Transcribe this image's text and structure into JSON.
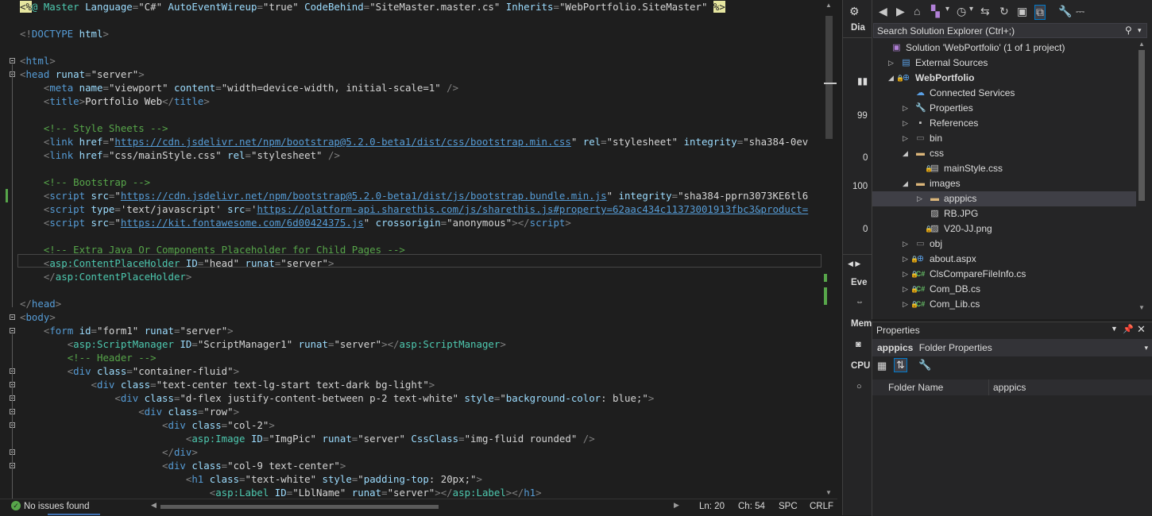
{
  "editor": {
    "lines": [
      [
        {
          "c": "dir",
          "t": "<%"
        },
        {
          "c": "asp",
          "t": "@ Master "
        },
        {
          "c": "attr",
          "t": "Language"
        },
        {
          "c": "pun",
          "t": "="
        },
        {
          "c": "val",
          "t": "\"C#\" "
        },
        {
          "c": "attr",
          "t": "AutoEventWireup"
        },
        {
          "c": "pun",
          "t": "="
        },
        {
          "c": "val",
          "t": "\"true\" "
        },
        {
          "c": "attr",
          "t": "CodeBehind"
        },
        {
          "c": "pun",
          "t": "="
        },
        {
          "c": "val",
          "t": "\"SiteMaster.master.cs\" "
        },
        {
          "c": "attr",
          "t": "Inherits"
        },
        {
          "c": "pun",
          "t": "="
        },
        {
          "c": "val",
          "t": "\"WebPortfolio.SiteMaster\" "
        },
        {
          "c": "dir",
          "t": "%>"
        }
      ],
      [],
      [
        {
          "c": "pun",
          "t": "<!"
        },
        {
          "c": "tag",
          "t": "DOCTYPE "
        },
        {
          "c": "attr",
          "t": "html"
        },
        {
          "c": "pun",
          "t": ">"
        }
      ],
      [],
      [
        {
          "c": "pun",
          "t": "<"
        },
        {
          "c": "tag",
          "t": "html"
        },
        {
          "c": "pun",
          "t": ">"
        }
      ],
      [
        {
          "c": "pun",
          "t": "<"
        },
        {
          "c": "tag",
          "t": "head "
        },
        {
          "c": "attr",
          "t": "runat"
        },
        {
          "c": "pun",
          "t": "="
        },
        {
          "c": "val",
          "t": "\"server\""
        },
        {
          "c": "pun",
          "t": ">"
        }
      ],
      [
        {
          "c": "txt",
          "t": "    "
        },
        {
          "c": "pun",
          "t": "<"
        },
        {
          "c": "tag",
          "t": "meta "
        },
        {
          "c": "attr",
          "t": "name"
        },
        {
          "c": "pun",
          "t": "="
        },
        {
          "c": "val",
          "t": "\"viewport\" "
        },
        {
          "c": "attr",
          "t": "content"
        },
        {
          "c": "pun",
          "t": "="
        },
        {
          "c": "val",
          "t": "\"width=device-width, initial-scale=1\" "
        },
        {
          "c": "pun",
          "t": "/>"
        }
      ],
      [
        {
          "c": "txt",
          "t": "    "
        },
        {
          "c": "pun",
          "t": "<"
        },
        {
          "c": "tag",
          "t": "title"
        },
        {
          "c": "pun",
          "t": ">"
        },
        {
          "c": "txt",
          "t": "Portfolio Web"
        },
        {
          "c": "pun",
          "t": "</"
        },
        {
          "c": "tag",
          "t": "title"
        },
        {
          "c": "pun",
          "t": ">"
        }
      ],
      [],
      [
        {
          "c": "txt",
          "t": "    "
        },
        {
          "c": "cmt",
          "t": "<!-- Style Sheets -->"
        }
      ],
      [
        {
          "c": "txt",
          "t": "    "
        },
        {
          "c": "pun",
          "t": "<"
        },
        {
          "c": "tag",
          "t": "link "
        },
        {
          "c": "attr",
          "t": "href"
        },
        {
          "c": "pun",
          "t": "="
        },
        {
          "c": "val",
          "t": "\""
        },
        {
          "c": "url",
          "t": "https://cdn.jsdelivr.net/npm/bootstrap@5.2.0-beta1/dist/css/bootstrap.min.css"
        },
        {
          "c": "val",
          "t": "\" "
        },
        {
          "c": "attr",
          "t": "rel"
        },
        {
          "c": "pun",
          "t": "="
        },
        {
          "c": "val",
          "t": "\"stylesheet\" "
        },
        {
          "c": "attr",
          "t": "integrity"
        },
        {
          "c": "pun",
          "t": "="
        },
        {
          "c": "val",
          "t": "\"sha384-0ev"
        }
      ],
      [
        {
          "c": "txt",
          "t": "    "
        },
        {
          "c": "pun",
          "t": "<"
        },
        {
          "c": "tag",
          "t": "link "
        },
        {
          "c": "attr",
          "t": "href"
        },
        {
          "c": "pun",
          "t": "="
        },
        {
          "c": "val",
          "t": "\"css/mainStyle.css\" "
        },
        {
          "c": "attr",
          "t": "rel"
        },
        {
          "c": "pun",
          "t": "="
        },
        {
          "c": "val",
          "t": "\"stylesheet\" "
        },
        {
          "c": "pun",
          "t": "/>"
        }
      ],
      [],
      [
        {
          "c": "txt",
          "t": "    "
        },
        {
          "c": "cmt",
          "t": "<!-- Bootstrap -->"
        }
      ],
      [
        {
          "c": "txt",
          "t": "    "
        },
        {
          "c": "pun",
          "t": "<"
        },
        {
          "c": "tag",
          "t": "script "
        },
        {
          "c": "attr",
          "t": "src"
        },
        {
          "c": "pun",
          "t": "="
        },
        {
          "c": "val",
          "t": "\""
        },
        {
          "c": "url",
          "t": "https://cdn.jsdelivr.net/npm/bootstrap@5.2.0-beta1/dist/js/bootstrap.bundle.min.js"
        },
        {
          "c": "val",
          "t": "\" "
        },
        {
          "c": "attr",
          "t": "integrity"
        },
        {
          "c": "pun",
          "t": "="
        },
        {
          "c": "val",
          "t": "\"sha384-pprn3073KE6tl6"
        }
      ],
      [
        {
          "c": "txt",
          "t": "    "
        },
        {
          "c": "pun",
          "t": "<"
        },
        {
          "c": "tag",
          "t": "script "
        },
        {
          "c": "attr",
          "t": "type"
        },
        {
          "c": "pun",
          "t": "="
        },
        {
          "c": "val",
          "t": "'text/javascript' "
        },
        {
          "c": "attr",
          "t": "src"
        },
        {
          "c": "pun",
          "t": "="
        },
        {
          "c": "val",
          "t": "'"
        },
        {
          "c": "url",
          "t": "https://platform-api.sharethis.com/js/sharethis.js#property=62aac434c11373001913fbc3&product="
        }
      ],
      [
        {
          "c": "txt",
          "t": "    "
        },
        {
          "c": "pun",
          "t": "<"
        },
        {
          "c": "tag",
          "t": "script "
        },
        {
          "c": "attr",
          "t": "src"
        },
        {
          "c": "pun",
          "t": "="
        },
        {
          "c": "val",
          "t": "\""
        },
        {
          "c": "url",
          "t": "https://kit.fontawesome.com/6d00424375.js"
        },
        {
          "c": "val",
          "t": "\" "
        },
        {
          "c": "attr",
          "t": "crossorigin"
        },
        {
          "c": "pun",
          "t": "="
        },
        {
          "c": "val",
          "t": "\"anonymous\""
        },
        {
          "c": "pun",
          "t": "></"
        },
        {
          "c": "tag",
          "t": "script"
        },
        {
          "c": "pun",
          "t": ">"
        }
      ],
      [],
      [
        {
          "c": "txt",
          "t": "    "
        },
        {
          "c": "cmt",
          "t": "<!-- Extra Java Or Components Placeholder for Child Pages -->"
        }
      ],
      [
        {
          "c": "txt",
          "t": "    "
        },
        {
          "c": "pun",
          "t": "<"
        },
        {
          "c": "asp",
          "t": "asp:ContentPlaceHolder "
        },
        {
          "c": "attr",
          "t": "ID"
        },
        {
          "c": "pun",
          "t": "="
        },
        {
          "c": "val",
          "t": "\"head\" "
        },
        {
          "c": "attr",
          "t": "runat"
        },
        {
          "c": "pun",
          "t": "="
        },
        {
          "c": "val",
          "t": "\"server\""
        },
        {
          "c": "pun",
          "t": ">"
        }
      ],
      [
        {
          "c": "txt",
          "t": "    "
        },
        {
          "c": "pun",
          "t": "</"
        },
        {
          "c": "asp",
          "t": "asp:ContentPlaceHolder"
        },
        {
          "c": "pun",
          "t": ">"
        }
      ],
      [],
      [
        {
          "c": "pun",
          "t": "</"
        },
        {
          "c": "tag",
          "t": "head"
        },
        {
          "c": "pun",
          "t": ">"
        }
      ],
      [
        {
          "c": "pun",
          "t": "<"
        },
        {
          "c": "tag",
          "t": "body"
        },
        {
          "c": "pun",
          "t": ">"
        }
      ],
      [
        {
          "c": "txt",
          "t": "    "
        },
        {
          "c": "pun",
          "t": "<"
        },
        {
          "c": "tag",
          "t": "form "
        },
        {
          "c": "attr",
          "t": "id"
        },
        {
          "c": "pun",
          "t": "="
        },
        {
          "c": "val",
          "t": "\"form1\" "
        },
        {
          "c": "attr",
          "t": "runat"
        },
        {
          "c": "pun",
          "t": "="
        },
        {
          "c": "val",
          "t": "\"server\""
        },
        {
          "c": "pun",
          "t": ">"
        }
      ],
      [
        {
          "c": "txt",
          "t": "        "
        },
        {
          "c": "pun",
          "t": "<"
        },
        {
          "c": "asp",
          "t": "asp:ScriptManager "
        },
        {
          "c": "attr",
          "t": "ID"
        },
        {
          "c": "pun",
          "t": "="
        },
        {
          "c": "val",
          "t": "\"ScriptManager1\" "
        },
        {
          "c": "attr",
          "t": "runat"
        },
        {
          "c": "pun",
          "t": "="
        },
        {
          "c": "val",
          "t": "\"server\""
        },
        {
          "c": "pun",
          "t": "></"
        },
        {
          "c": "asp",
          "t": "asp:ScriptManager"
        },
        {
          "c": "pun",
          "t": ">"
        }
      ],
      [
        {
          "c": "txt",
          "t": "        "
        },
        {
          "c": "cmt",
          "t": "<!-- Header -->"
        }
      ],
      [
        {
          "c": "txt",
          "t": "        "
        },
        {
          "c": "pun",
          "t": "<"
        },
        {
          "c": "tag",
          "t": "div "
        },
        {
          "c": "attr",
          "t": "class"
        },
        {
          "c": "pun",
          "t": "="
        },
        {
          "c": "val",
          "t": "\"container-fluid\""
        },
        {
          "c": "pun",
          "t": ">"
        }
      ],
      [
        {
          "c": "txt",
          "t": "            "
        },
        {
          "c": "pun",
          "t": "<"
        },
        {
          "c": "tag",
          "t": "div "
        },
        {
          "c": "attr",
          "t": "class"
        },
        {
          "c": "pun",
          "t": "="
        },
        {
          "c": "val",
          "t": "\"text-center text-lg-start text-dark bg-light\""
        },
        {
          "c": "pun",
          "t": ">"
        }
      ],
      [
        {
          "c": "txt",
          "t": "                "
        },
        {
          "c": "pun",
          "t": "<"
        },
        {
          "c": "tag",
          "t": "div "
        },
        {
          "c": "attr",
          "t": "class"
        },
        {
          "c": "pun",
          "t": "="
        },
        {
          "c": "val",
          "t": "\"d-flex justify-content-between p-2 text-white\" "
        },
        {
          "c": "attr",
          "t": "style"
        },
        {
          "c": "pun",
          "t": "="
        },
        {
          "c": "val",
          "t": "\""
        },
        {
          "c": "attr",
          "t": "background-color"
        },
        {
          "c": "val",
          "t": ": blue;\""
        },
        {
          "c": "pun",
          "t": ">"
        }
      ],
      [
        {
          "c": "txt",
          "t": "                    "
        },
        {
          "c": "pun",
          "t": "<"
        },
        {
          "c": "tag",
          "t": "div "
        },
        {
          "c": "attr",
          "t": "class"
        },
        {
          "c": "pun",
          "t": "="
        },
        {
          "c": "val",
          "t": "\"row\""
        },
        {
          "c": "pun",
          "t": ">"
        }
      ],
      [
        {
          "c": "txt",
          "t": "                        "
        },
        {
          "c": "pun",
          "t": "<"
        },
        {
          "c": "tag",
          "t": "div "
        },
        {
          "c": "attr",
          "t": "class"
        },
        {
          "c": "pun",
          "t": "="
        },
        {
          "c": "val",
          "t": "\"col-2\""
        },
        {
          "c": "pun",
          "t": ">"
        }
      ],
      [
        {
          "c": "txt",
          "t": "                            "
        },
        {
          "c": "pun",
          "t": "<"
        },
        {
          "c": "asp",
          "t": "asp:Image "
        },
        {
          "c": "attr",
          "t": "ID"
        },
        {
          "c": "pun",
          "t": "="
        },
        {
          "c": "val",
          "t": "\"ImgPic\" "
        },
        {
          "c": "attr",
          "t": "runat"
        },
        {
          "c": "pun",
          "t": "="
        },
        {
          "c": "val",
          "t": "\"server\" "
        },
        {
          "c": "attr",
          "t": "CssClass"
        },
        {
          "c": "pun",
          "t": "="
        },
        {
          "c": "val",
          "t": "\"img-fluid rounded\" "
        },
        {
          "c": "pun",
          "t": "/>"
        }
      ],
      [
        {
          "c": "txt",
          "t": "                        "
        },
        {
          "c": "pun",
          "t": "</"
        },
        {
          "c": "tag",
          "t": "div"
        },
        {
          "c": "pun",
          "t": ">"
        }
      ],
      [
        {
          "c": "txt",
          "t": "                        "
        },
        {
          "c": "pun",
          "t": "<"
        },
        {
          "c": "tag",
          "t": "div "
        },
        {
          "c": "attr",
          "t": "class"
        },
        {
          "c": "pun",
          "t": "="
        },
        {
          "c": "val",
          "t": "\"col-9 text-center\""
        },
        {
          "c": "pun",
          "t": ">"
        }
      ],
      [
        {
          "c": "txt",
          "t": "                            "
        },
        {
          "c": "pun",
          "t": "<"
        },
        {
          "c": "tag",
          "t": "h1 "
        },
        {
          "c": "attr",
          "t": "class"
        },
        {
          "c": "pun",
          "t": "="
        },
        {
          "c": "val",
          "t": "\"text-white\" "
        },
        {
          "c": "attr",
          "t": "style"
        },
        {
          "c": "pun",
          "t": "="
        },
        {
          "c": "val",
          "t": "\""
        },
        {
          "c": "attr",
          "t": "padding-top"
        },
        {
          "c": "val",
          "t": ": 20px;\""
        },
        {
          "c": "pun",
          "t": ">"
        }
      ],
      [
        {
          "c": "txt",
          "t": "                                "
        },
        {
          "c": "pun",
          "t": "<"
        },
        {
          "c": "asp",
          "t": "asp:Label "
        },
        {
          "c": "attr",
          "t": "ID"
        },
        {
          "c": "pun",
          "t": "="
        },
        {
          "c": "val",
          "t": "\"LblName\" "
        },
        {
          "c": "attr",
          "t": "runat"
        },
        {
          "c": "pun",
          "t": "="
        },
        {
          "c": "val",
          "t": "\"server\""
        },
        {
          "c": "pun",
          "t": "></"
        },
        {
          "c": "asp",
          "t": "asp:Label"
        },
        {
          "c": "pun",
          "t": "></"
        },
        {
          "c": "tag",
          "t": "h1"
        },
        {
          "c": "pun",
          "t": ">"
        }
      ]
    ]
  },
  "status": {
    "issues": "No issues found",
    "line": "Ln: 20",
    "col": "Ch: 54",
    "spacing": "SPC",
    "eol": "CRLF"
  },
  "middle_panel": {
    "diagnostics_label": "Dia",
    "values": [
      "99",
      "0",
      "100",
      "0"
    ],
    "events_label": "Eve",
    "memory_label": "Mem",
    "cpu_label": "CPU"
  },
  "solution_explorer": {
    "search_placeholder": "Search Solution Explorer (Ctrl+;)",
    "items": [
      {
        "label": "Solution 'WebPortfolio' (1 of 1 project)",
        "icon": "solution-icon"
      },
      {
        "label": "External Sources",
        "icon": "external-sources-icon"
      },
      {
        "label": "WebPortfolio",
        "icon": "web-project-icon"
      },
      {
        "label": "Connected Services",
        "icon": "connected-services-icon"
      },
      {
        "label": "Properties",
        "icon": "wrench-icon"
      },
      {
        "label": "References",
        "icon": "references-icon"
      },
      {
        "label": "bin",
        "icon": "folder-icon"
      },
      {
        "label": "css",
        "icon": "folder-icon"
      },
      {
        "label": "mainStyle.css",
        "icon": "css-file-icon"
      },
      {
        "label": "images",
        "icon": "folder-icon"
      },
      {
        "label": "apppics",
        "icon": "folder-icon"
      },
      {
        "label": "RB.JPG",
        "icon": "image-file-icon"
      },
      {
        "label": "V20-JJ.png",
        "icon": "image-file-icon"
      },
      {
        "label": "obj",
        "icon": "folder-icon"
      },
      {
        "label": "about.aspx",
        "icon": "aspx-file-icon"
      },
      {
        "label": "ClsCompareFileInfo.cs",
        "icon": "csharp-file-icon"
      },
      {
        "label": "Com_DB.cs",
        "icon": "csharp-file-icon"
      },
      {
        "label": "Com_Lib.cs",
        "icon": "csharp-file-icon"
      }
    ]
  },
  "properties": {
    "title": "Properties",
    "object_name": "apppics",
    "object_type": "Folder Properties",
    "row_name": "Folder Name",
    "row_value": "apppics"
  },
  "colors": {
    "bg": "#1e1e1e",
    "panel": "#252526",
    "accent_green": "#57a64a",
    "selection": "#3f3f46"
  }
}
